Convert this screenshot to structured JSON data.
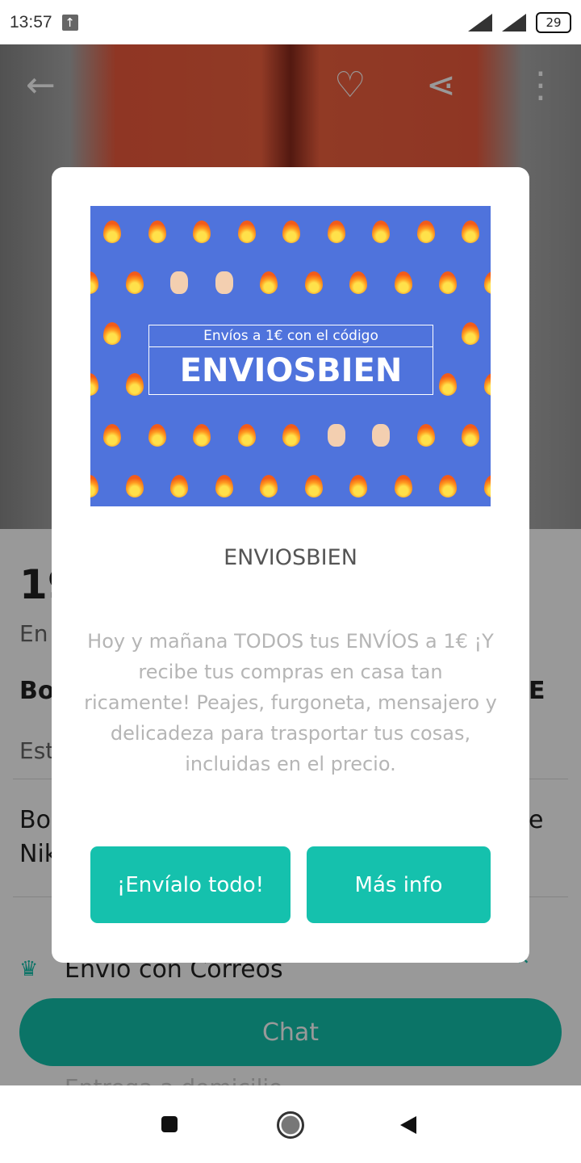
{
  "status_bar": {
    "time": "13:57",
    "battery": "29"
  },
  "product_fragments": {
    "price": "19",
    "shipping_hint": "En",
    "title_left": "Bo",
    "title_right": "E",
    "state": "Est",
    "desc_left_1": "Bo",
    "desc_right_1": "e",
    "desc_left_2": "Nik"
  },
  "shipping": {
    "label": "Envío con Correos",
    "sub": "Entrega a domicilio"
  },
  "chat_button": "Chat",
  "modal": {
    "banner": {
      "line1": "Envíos a 1€ con el código",
      "code": "ENVIOSBIEN",
      "background": "#4f73dc"
    },
    "title": "ENVIOSBIEN",
    "body": "Hoy y mañana TODOS tus ENVÍOS a 1€ ¡Y recibe tus compras en casa tan ricamente! Peajes, furgoneta, mensajero y delicadeza para trasportar tus cosas, incluidas en el precio.",
    "primary_button": "¡Envíalo todo!",
    "secondary_button": "Más info",
    "accent": "#15c1ad"
  },
  "icons": [
    "back-arrow",
    "heart",
    "share",
    "more-vertical",
    "correos-crown",
    "chevron-up",
    "fire-emoji",
    "ok-hand-emoji"
  ]
}
